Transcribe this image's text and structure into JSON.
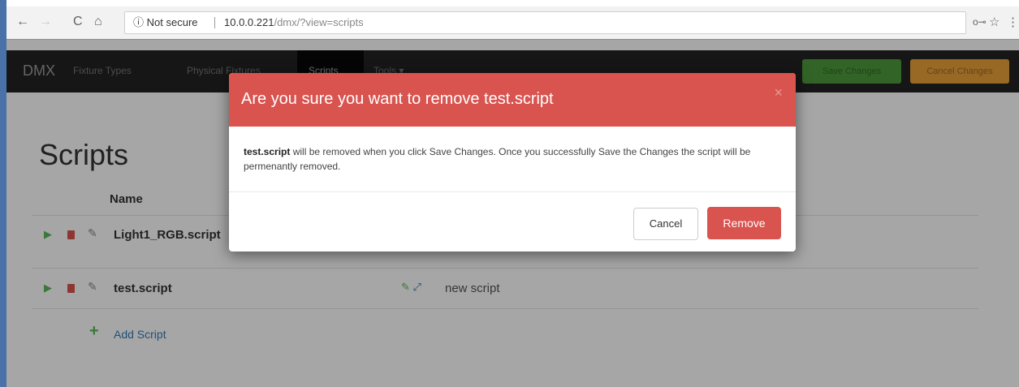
{
  "browser": {
    "security_label": "Not secure",
    "url_host": "10.0.0.221",
    "url_path": "/dmx/?view=scripts",
    "back_icon": "←",
    "forward_icon": "→",
    "reload_icon": "C",
    "home_icon": "⌂",
    "info_icon": "ⓘ",
    "key_icon": "o⊸",
    "star_icon": "☆",
    "menu_icon": "⋮"
  },
  "nav": {
    "brand": "DMX",
    "links": [
      "Fixture Types",
      "Physical Fixtures",
      "Scripts",
      "Tools ▾"
    ],
    "save_label": "Save Changes",
    "cancel_label": "Cancel Changes"
  },
  "page": {
    "title": "Scripts",
    "column_name": "Name",
    "rows": [
      {
        "name": "Light1_RGB.script",
        "description": ""
      },
      {
        "name": "test.script",
        "description": "new script"
      }
    ],
    "add_label": "Add Script",
    "add_icon": "+"
  },
  "modal": {
    "title": "Are you sure you want to remove test.script",
    "close_icon": "×",
    "body_bold": "test.script",
    "body_text": " will be removed when you click Save Changes. Once you successfully Save the Changes the script will be permenantly removed.",
    "cancel_label": "Cancel",
    "remove_label": "Remove"
  },
  "colors": {
    "danger": "#d9534f",
    "success": "#5cb85c",
    "warning": "#f0ad4e",
    "navbar": "#222222"
  }
}
